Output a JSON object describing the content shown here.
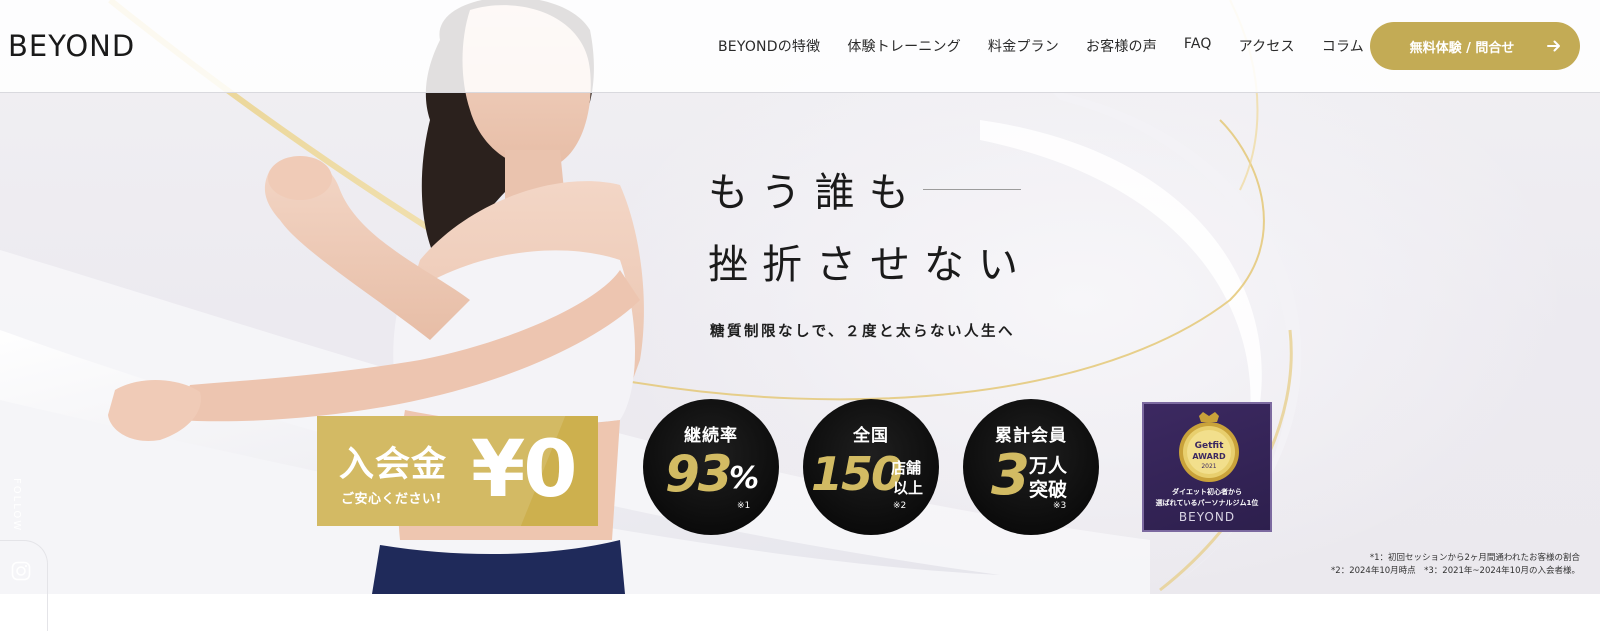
{
  "header": {
    "logo_text": "BEYOND",
    "nav": [
      {
        "label": "BEYONDの特徴"
      },
      {
        "label": "体験トレーニング"
      },
      {
        "label": "料金プラン"
      },
      {
        "label": "お客様の声"
      },
      {
        "label": "FAQ"
      },
      {
        "label": "アクセス"
      },
      {
        "label": "コラム"
      }
    ],
    "cta": {
      "label": "無料体験 / 問合せ",
      "icon": "arrow-right-icon"
    }
  },
  "hero": {
    "headline_line1": "もう誰も",
    "headline_line2": "挫折させない",
    "subcopy": "糖質制限なしで、２度と太らない人生へ"
  },
  "fee": {
    "label": "入会金",
    "value": "¥0",
    "note": "ご安心ください!"
  },
  "stats": [
    {
      "title": "継続率",
      "number": "93",
      "suffix": "%",
      "ref": "※1"
    },
    {
      "title": "全国",
      "number": "150",
      "suffix_top": "店舗",
      "suffix_bottom": "以上",
      "ref": "※2"
    },
    {
      "title": "累計会員",
      "number": "3",
      "suffix_top": "万人",
      "suffix_bottom": "突破",
      "ref": "※3"
    }
  ],
  "award": {
    "medal_brand": "Getfit",
    "medal_title": "AWARD",
    "medal_year": "2021",
    "text_line1": "ダイエット初心者から",
    "text_line2": "選ばれているパーソナルジム1位",
    "logo_text": "BEYOND"
  },
  "footnotes": {
    "line1": "*1：初回セッションから2ヶ月間通われたお客様の割合",
    "line2": "*2：2024年10月時点　*3：2021年~2024年10月の入会者様。"
  },
  "sidebar": {
    "follow_label": "FOLLOW",
    "icon": "instagram-icon"
  },
  "colors": {
    "gold": "#c3ab55",
    "fee_gold": "#cdb04e",
    "stat_number_gold": "#d2bb63",
    "award_purple": "#3c2961"
  }
}
